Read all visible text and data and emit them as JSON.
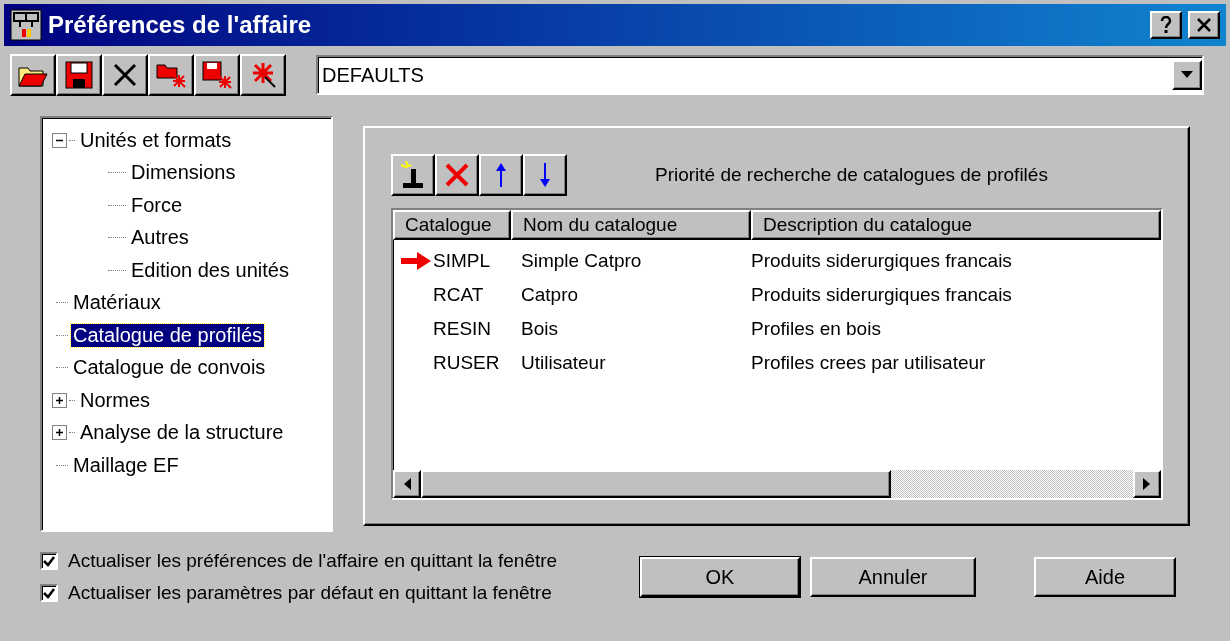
{
  "window": {
    "title": "Préférences de l'affaire"
  },
  "toolbar": {
    "buttons": [
      {
        "kind": "open"
      },
      {
        "kind": "save"
      },
      {
        "kind": "delete"
      },
      {
        "kind": "open-star"
      },
      {
        "kind": "save-star"
      },
      {
        "kind": "star"
      }
    ],
    "preset": {
      "value": "DEFAULTS"
    }
  },
  "tree": {
    "items": [
      {
        "label": "Unités et formats",
        "selected": false,
        "expanded": true,
        "children": [
          {
            "label": "Dimensions",
            "selected": false
          },
          {
            "label": "Force",
            "selected": false
          },
          {
            "label": "Autres",
            "selected": false
          },
          {
            "label": "Edition des unités",
            "selected": false
          }
        ]
      },
      {
        "label": "Matériaux",
        "selected": false
      },
      {
        "label": "Catalogue de profilés",
        "selected": true
      },
      {
        "label": "Catalogue de convois",
        "selected": false
      },
      {
        "label": "Normes",
        "selected": false,
        "expanded": false
      },
      {
        "label": "Analyse de la structure",
        "selected": false,
        "expanded": false
      },
      {
        "label": "Maillage EF",
        "selected": false
      }
    ]
  },
  "panel": {
    "tools": [
      {
        "kind": "add"
      },
      {
        "kind": "remove"
      },
      {
        "kind": "up"
      },
      {
        "kind": "down"
      }
    ],
    "heading": "Priorité de recherche de catalogues de profilés",
    "table": {
      "columns": [
        "Catalogue",
        "Nom du catalogue",
        "Description du catalogue"
      ],
      "rows": [
        {
          "marked": true,
          "cells": [
            "SIMPL",
            "Simple Catpro",
            "Produits siderurgiques francais"
          ]
        },
        {
          "marked": false,
          "cells": [
            "RCAT",
            "Catpro",
            "Produits siderurgiques francais"
          ]
        },
        {
          "marked": false,
          "cells": [
            "RESIN",
            "Bois",
            "Profiles en bois"
          ]
        },
        {
          "marked": false,
          "cells": [
            "RUSER",
            "Utilisateur",
            "Profiles crees par utilisateur"
          ]
        }
      ]
    }
  },
  "options": [
    {
      "label": "Actualiser les préférences de l'affaire en quittant la fenêtre",
      "checked": true
    },
    {
      "label": "Actualiser les paramètres par défaut en quittant la fenêtre",
      "checked": true
    }
  ],
  "buttons": [
    {
      "label": "OK",
      "default": true
    },
    {
      "label": "Annuler",
      "default": false
    },
    {
      "label": "Aide",
      "default": false
    }
  ]
}
